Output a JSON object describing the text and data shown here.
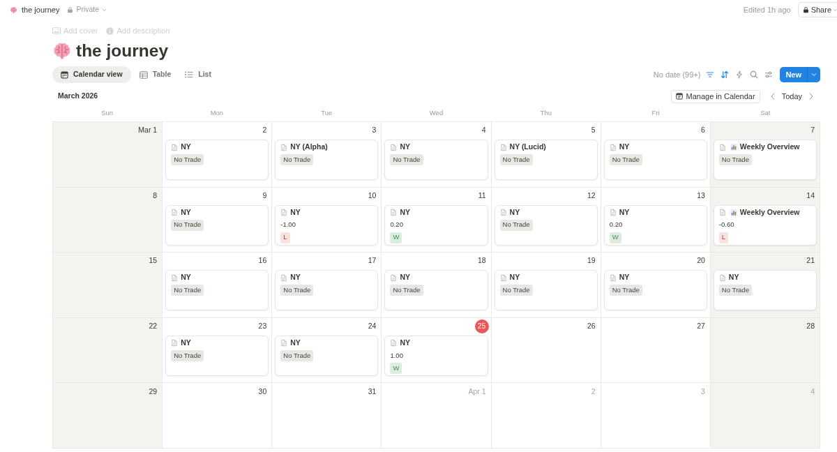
{
  "topbar": {
    "breadcrumb": "the journey",
    "privacy": "Private",
    "edited": "Edited 1h ago",
    "share": "Share"
  },
  "page": {
    "add_cover": "Add cover",
    "add_description": "Add description",
    "title": "the journey"
  },
  "views": [
    {
      "kind": "calendar",
      "label": "Calendar view",
      "selected": true
    },
    {
      "kind": "table",
      "label": "Table",
      "selected": false
    },
    {
      "kind": "list",
      "label": "List",
      "selected": false
    }
  ],
  "toolbar": {
    "no_date": "No date (99+)",
    "filter_active": true,
    "sort_active": true,
    "new_button": "New"
  },
  "calendar": {
    "month": "March 2026",
    "manage": "Manage in Calendar",
    "today_button": "Today",
    "weekdays": [
      {
        "label": "Sun",
        "weekend": true
      },
      {
        "label": "Mon",
        "weekend": false
      },
      {
        "label": "Tue",
        "weekend": false
      },
      {
        "label": "Wed",
        "weekend": false
      },
      {
        "label": "Thu",
        "weekend": false
      },
      {
        "label": "Fri",
        "weekend": false
      },
      {
        "label": "Sat",
        "weekend": true
      }
    ],
    "weeks": [
      {
        "days": [
          {
            "date": "Mar 1",
            "in_month": true,
            "today": false
          },
          {
            "date": "2",
            "in_month": true,
            "today": false,
            "items": [
              {
                "kind": "daily",
                "title": "NY",
                "tag": {
                  "label": "No Trade",
                  "color": "#e8e7e4"
                }
              }
            ]
          },
          {
            "date": "3",
            "in_month": true,
            "today": false,
            "items": [
              {
                "kind": "daily",
                "title": "NY (Alpha)",
                "tag": {
                  "label": "No Trade",
                  "color": "#e8e7e4"
                }
              }
            ]
          },
          {
            "date": "4",
            "in_month": true,
            "today": false,
            "items": [
              {
                "kind": "daily",
                "title": "NY",
                "tag": {
                  "label": "No Trade",
                  "color": "#e8e7e4"
                }
              }
            ]
          },
          {
            "date": "5",
            "in_month": true,
            "today": false,
            "items": [
              {
                "kind": "daily",
                "title": "NY (Lucid)",
                "tag": {
                  "label": "No Trade",
                  "color": "#e8e7e4"
                }
              }
            ]
          },
          {
            "date": "6",
            "in_month": true,
            "today": false,
            "items": [
              {
                "kind": "daily",
                "title": "NY",
                "tag": {
                  "label": "No Trade",
                  "color": "#e8e7e4"
                }
              }
            ]
          },
          {
            "date": "7",
            "in_month": true,
            "today": false,
            "items": [
              {
                "kind": "weekly",
                "title": "Weekly Overview",
                "tag": {
                  "label": "No Trade",
                  "color": "#e8e7e4"
                }
              }
            ]
          }
        ]
      },
      {
        "days": [
          {
            "date": "8",
            "in_month": true,
            "today": false
          },
          {
            "date": "9",
            "in_month": true,
            "today": false,
            "items": [
              {
                "kind": "daily",
                "title": "NY",
                "tag": {
                  "label": "No Trade",
                  "color": "#e8e7e4"
                }
              }
            ]
          },
          {
            "date": "10",
            "in_month": true,
            "today": false,
            "items": [
              {
                "kind": "daily",
                "title": "NY",
                "pnl": "-1.00",
                "tag": {
                  "label": "L",
                  "color": "#fbe1de"
                }
              }
            ]
          },
          {
            "date": "11",
            "in_month": true,
            "today": false,
            "items": [
              {
                "kind": "daily",
                "title": "NY",
                "pnl": "0.20",
                "tag": {
                  "label": "W",
                  "color": "#dbeddf"
                }
              }
            ]
          },
          {
            "date": "12",
            "in_month": true,
            "today": false,
            "items": [
              {
                "kind": "daily",
                "title": "NY",
                "tag": {
                  "label": "No Trade",
                  "color": "#e8e7e4"
                }
              }
            ]
          },
          {
            "date": "13",
            "in_month": true,
            "today": false,
            "items": [
              {
                "kind": "daily",
                "title": "NY",
                "pnl": "0.20",
                "tag": {
                  "label": "W",
                  "color": "#dbeddf"
                }
              }
            ]
          },
          {
            "date": "14",
            "in_month": true,
            "today": false,
            "items": [
              {
                "kind": "weekly",
                "title": "Weekly Overview",
                "pnl": "-0.60",
                "tag": {
                  "label": "L",
                  "color": "#fbe1de"
                }
              }
            ]
          }
        ]
      },
      {
        "days": [
          {
            "date": "15",
            "in_month": true,
            "today": false
          },
          {
            "date": "16",
            "in_month": true,
            "today": false,
            "items": [
              {
                "kind": "daily",
                "title": "NY",
                "tag": {
                  "label": "No Trade",
                  "color": "#e8e7e4"
                }
              }
            ]
          },
          {
            "date": "17",
            "in_month": true,
            "today": false,
            "items": [
              {
                "kind": "daily",
                "title": "NY",
                "tag": {
                  "label": "No Trade",
                  "color": "#e8e7e4"
                }
              }
            ]
          },
          {
            "date": "18",
            "in_month": true,
            "today": false,
            "items": [
              {
                "kind": "daily",
                "title": "NY",
                "tag": {
                  "label": "No Trade",
                  "color": "#e8e7e4"
                }
              }
            ]
          },
          {
            "date": "19",
            "in_month": true,
            "today": false,
            "items": [
              {
                "kind": "daily",
                "title": "NY",
                "tag": {
                  "label": "No Trade",
                  "color": "#e8e7e4"
                }
              }
            ]
          },
          {
            "date": "20",
            "in_month": true,
            "today": false,
            "items": [
              {
                "kind": "daily",
                "title": "NY",
                "tag": {
                  "label": "No Trade",
                  "color": "#e8e7e4"
                }
              }
            ]
          },
          {
            "date": "21",
            "in_month": true,
            "today": false,
            "items": [
              {
                "kind": "daily",
                "title": "NY",
                "tag": {
                  "label": "No Trade",
                  "color": "#e8e7e4"
                }
              }
            ]
          }
        ]
      },
      {
        "days": [
          {
            "date": "22",
            "in_month": true,
            "today": false
          },
          {
            "date": "23",
            "in_month": true,
            "today": false,
            "items": [
              {
                "kind": "daily",
                "title": "NY",
                "tag": {
                  "label": "No Trade",
                  "color": "#e8e7e4"
                }
              }
            ]
          },
          {
            "date": "24",
            "in_month": true,
            "today": false,
            "items": [
              {
                "kind": "daily",
                "title": "NY",
                "tag": {
                  "label": "No Trade",
                  "color": "#e8e7e4"
                }
              }
            ]
          },
          {
            "date": "25",
            "in_month": true,
            "today": true,
            "items": [
              {
                "kind": "daily",
                "title": "NY",
                "pnl": "1.00",
                "tag": {
                  "label": "W",
                  "color": "#dbeddf"
                }
              }
            ]
          },
          {
            "date": "26",
            "in_month": true,
            "today": false
          },
          {
            "date": "27",
            "in_month": true,
            "today": false
          },
          {
            "date": "28",
            "in_month": true,
            "today": false
          }
        ]
      },
      {
        "days": [
          {
            "date": "29",
            "in_month": true,
            "today": false
          },
          {
            "date": "30",
            "in_month": true,
            "today": false
          },
          {
            "date": "31",
            "in_month": true,
            "today": false
          },
          {
            "date": "Apr 1",
            "in_month": false,
            "today": false
          },
          {
            "date": "2",
            "in_month": false,
            "today": false
          },
          {
            "date": "3",
            "in_month": false,
            "today": false
          },
          {
            "date": "4",
            "in_month": false,
            "today": false
          }
        ]
      }
    ]
  }
}
